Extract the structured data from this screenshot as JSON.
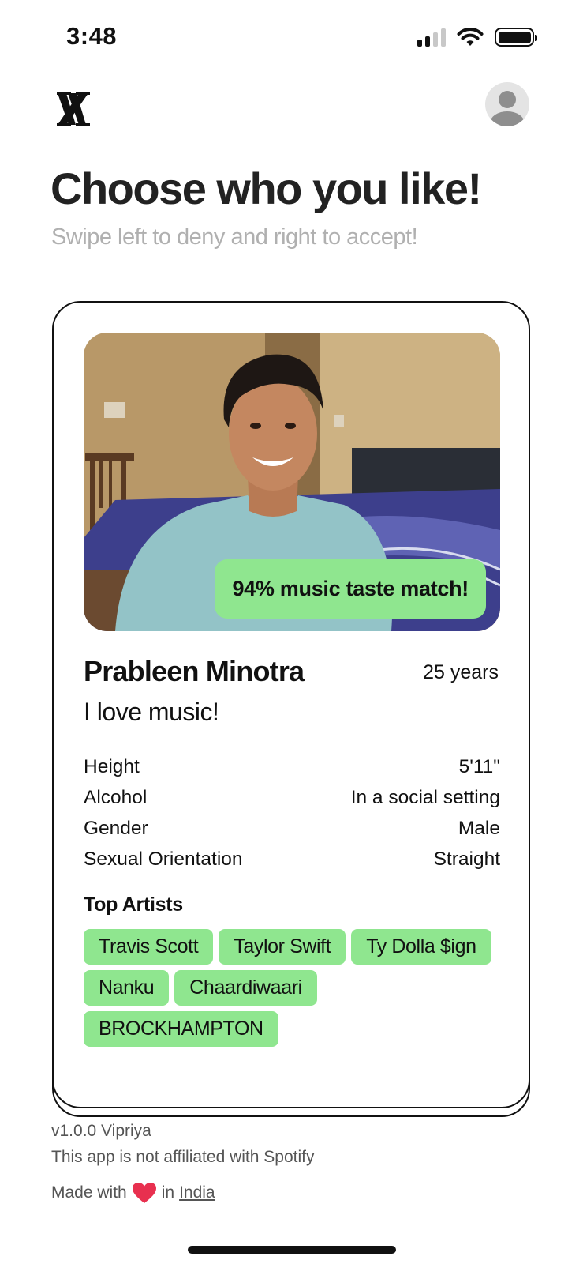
{
  "status_bar": {
    "time": "3:48",
    "icons": [
      "cellular-signal-icon",
      "wifi-icon",
      "battery-icon"
    ]
  },
  "header": {
    "logo_icon": "vipriya-logo",
    "profile_icon": "profile-avatar-icon",
    "title": "Choose who you like!",
    "subtitle": "Swipe left to deny and right to accept!"
  },
  "card": {
    "match_text": "94% music taste match!",
    "name": "Prableen Minotra",
    "age": "25 years",
    "bio": "I love music!",
    "details": [
      {
        "label": "Height",
        "value": "5'11\""
      },
      {
        "label": "Alcohol",
        "value": "In a social setting"
      },
      {
        "label": "Gender",
        "value": "Male"
      },
      {
        "label": "Sexual Orientation",
        "value": "Straight"
      }
    ],
    "top_artists_heading": "Top Artists",
    "top_artists": [
      "Travis Scott",
      "Taylor Swift",
      "Ty Dolla $ign",
      "Nanku",
      "Chaardiwaari",
      "BROCKHAMPTON"
    ]
  },
  "footer": {
    "version": "v1.0.0 Vipriya",
    "disclaimer": "This app is not affiliated with Spotify",
    "made_with": "Made with",
    "in_text": "in",
    "country_link": "India"
  },
  "colors": {
    "accent_green": "#8fe68f",
    "subtitle_gray": "#b0b0b0",
    "heart_red": "#e8304f"
  }
}
